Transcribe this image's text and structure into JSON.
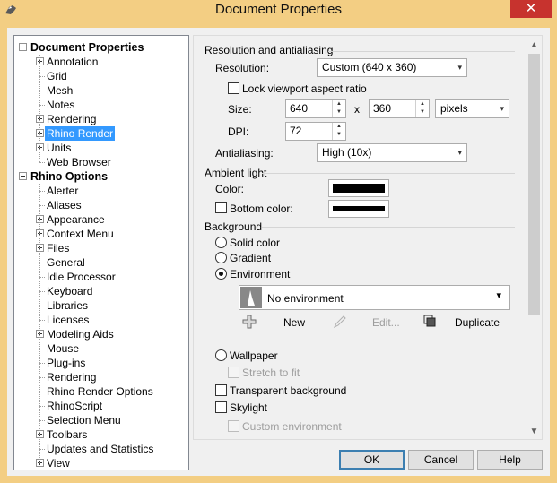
{
  "window": {
    "title": "Document Properties",
    "close_glyph": "✕"
  },
  "tree": {
    "items": [
      {
        "label": "Document Properties",
        "level": 0,
        "root": true,
        "expander": "minus"
      },
      {
        "label": "Annotation",
        "level": 1,
        "expander": "plus"
      },
      {
        "label": "Grid",
        "level": 1
      },
      {
        "label": "Mesh",
        "level": 1
      },
      {
        "label": "Notes",
        "level": 1
      },
      {
        "label": "Rendering",
        "level": 1,
        "expander": "plus"
      },
      {
        "label": "Rhino Render",
        "level": 1,
        "expander": "plus",
        "selected": true
      },
      {
        "label": "Units",
        "level": 1,
        "expander": "plus"
      },
      {
        "label": "Web Browser",
        "level": 1
      },
      {
        "label": "Rhino Options",
        "level": 0,
        "root": true,
        "expander": "minus"
      },
      {
        "label": "Alerter",
        "level": 1
      },
      {
        "label": "Aliases",
        "level": 1
      },
      {
        "label": "Appearance",
        "level": 1,
        "expander": "plus"
      },
      {
        "label": "Context Menu",
        "level": 1,
        "expander": "plus"
      },
      {
        "label": "Files",
        "level": 1,
        "expander": "plus"
      },
      {
        "label": "General",
        "level": 1
      },
      {
        "label": "Idle Processor",
        "level": 1
      },
      {
        "label": "Keyboard",
        "level": 1
      },
      {
        "label": "Libraries",
        "level": 1
      },
      {
        "label": "Licenses",
        "level": 1
      },
      {
        "label": "Modeling Aids",
        "level": 1,
        "expander": "plus"
      },
      {
        "label": "Mouse",
        "level": 1
      },
      {
        "label": "Plug-ins",
        "level": 1
      },
      {
        "label": "Rendering",
        "level": 1
      },
      {
        "label": "Rhino Render Options",
        "level": 1
      },
      {
        "label": "RhinoScript",
        "level": 1
      },
      {
        "label": "Selection Menu",
        "level": 1
      },
      {
        "label": "Toolbars",
        "level": 1,
        "expander": "plus"
      },
      {
        "label": "Updates and Statistics",
        "level": 1
      },
      {
        "label": "View",
        "level": 1,
        "expander": "plus"
      }
    ]
  },
  "resolution": {
    "section": "Resolution and antialiasing",
    "resolution_label": "Resolution:",
    "resolution_value": "Custom  (640 x 360)",
    "lock_label": "Lock viewport aspect ratio",
    "size_label": "Size:",
    "width": "640",
    "x_label": "x",
    "height": "360",
    "units": "pixels",
    "dpi_label": "DPI:",
    "dpi": "72",
    "antialias_label": "Antialiasing:",
    "antialias_value": "High (10x)"
  },
  "ambient": {
    "section": "Ambient light",
    "color_label": "Color:",
    "bottom_label": "Bottom color:",
    "color": "#000000"
  },
  "background": {
    "section": "Background",
    "solid": "Solid color",
    "gradient": "Gradient",
    "environment": "Environment",
    "env_value": "No environment",
    "new": "New",
    "edit": "Edit...",
    "duplicate": "Duplicate",
    "wallpaper": "Wallpaper",
    "stretch": "Stretch to fit",
    "transparent": "Transparent background",
    "skylight": "Skylight",
    "custom_env": "Custom environment",
    "selected": "Environment"
  },
  "buttons": {
    "ok": "OK",
    "cancel": "Cancel",
    "help": "Help"
  },
  "icons": {
    "app": "rhino-icon",
    "combo_arrow": "▾"
  }
}
